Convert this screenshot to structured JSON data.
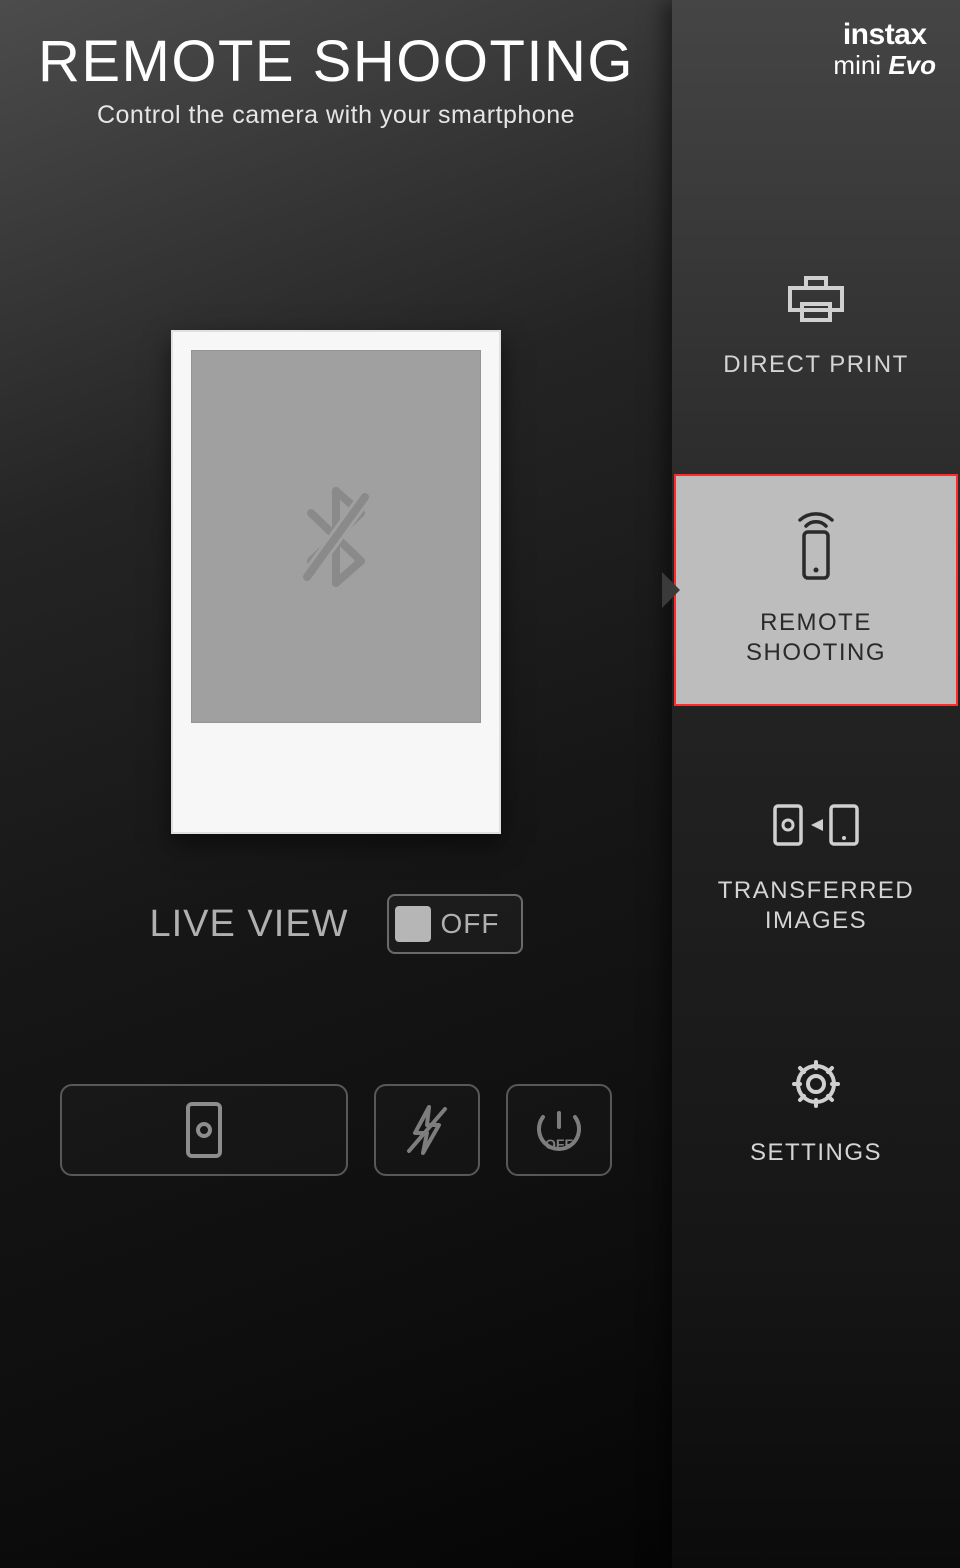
{
  "header": {
    "title": "REMOTE SHOOTING",
    "subtitle": "Control the camera with your smartphone"
  },
  "logo": {
    "line1": "instax",
    "line2_a": "mini ",
    "line2_b": "Evo"
  },
  "live_view": {
    "label": "LIVE VIEW",
    "state": "OFF"
  },
  "controls": {
    "shutter_icon": "camera-phone-icon",
    "flash_icon": "flash-off-icon",
    "timer_icon": "timer-off-icon",
    "timer_text": "OFF"
  },
  "sidebar": {
    "items": [
      {
        "label": "DIRECT PRINT",
        "icon": "printer-icon"
      },
      {
        "label_line1": "REMOTE",
        "label_line2": "SHOOTING",
        "icon": "phone-remote-icon"
      },
      {
        "label_line1": "TRANSFERRED",
        "label_line2": "IMAGES",
        "icon": "transfer-icon"
      },
      {
        "label": "SETTINGS",
        "icon": "gear-icon"
      }
    ],
    "selected_index": 1
  },
  "preview": {
    "status_icon": "bluetooth-disabled-icon"
  }
}
